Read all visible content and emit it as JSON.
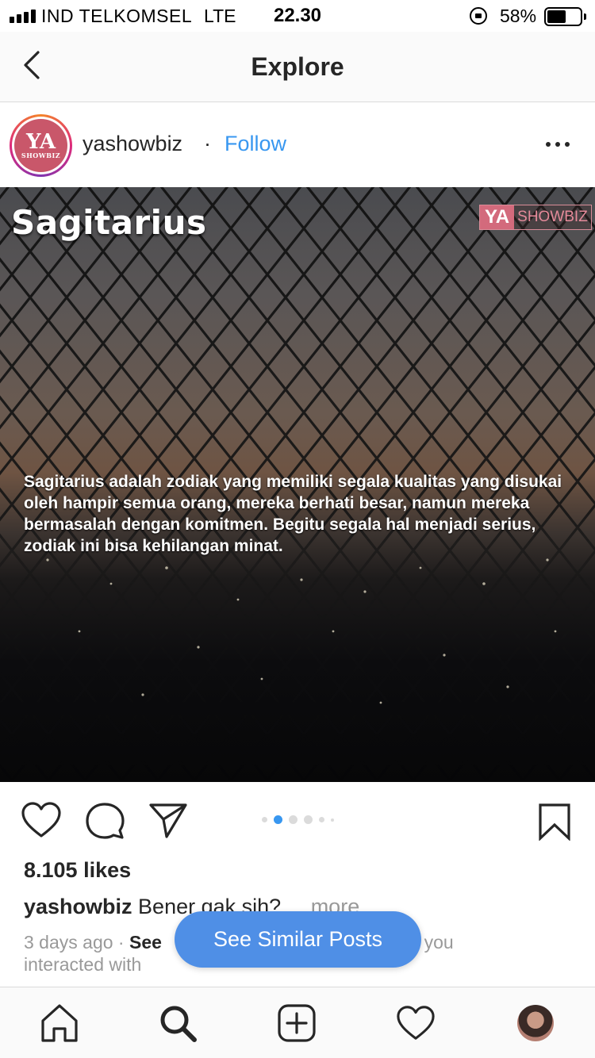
{
  "status_bar": {
    "carrier": "IND TELKOMSEL",
    "network": "LTE",
    "time": "22.30",
    "battery_percent": "58%",
    "battery_level": 0.58
  },
  "nav": {
    "title": "Explore"
  },
  "post": {
    "username": "yashowbiz",
    "separator": "·",
    "follow_label": "Follow",
    "avatar_logo": {
      "ya": "YA",
      "sub": "SHOWBIZ"
    },
    "image": {
      "title": "Sagitarius",
      "watermark_ya": "YA",
      "watermark_showbiz": "SHOWBIZ",
      "caption": "Sagitarius adalah zodiak yang memiliki segala kualitas yang disukai oleh hampir semua orang, mereka berhati besar, namun mereka bermasalah dengan komitmen. Begitu segala hal menjadi serius, zodiak ini bisa kehilangan minat."
    },
    "likes": "8.105 likes",
    "caption_user": "yashowbiz",
    "caption_text": "Bener gak sih?",
    "caption_more": "... more",
    "timestamp": "3 days ago",
    "meta_sep": " · ",
    "see_label": "See",
    "meta_rest": "ts you",
    "meta_line2": "interacted with",
    "carousel": {
      "count": 6,
      "active": 1
    }
  },
  "similar_button": "See Similar Posts",
  "icons": {
    "back": "chevron-left-icon",
    "more": "ellipsis-icon",
    "like": "heart-icon",
    "comment": "comment-bubble-icon",
    "share": "paper-plane-icon",
    "save": "bookmark-icon",
    "home": "home-icon",
    "search": "search-icon",
    "add": "plus-square-icon",
    "activity": "heart-icon",
    "profile": "profile-avatar"
  },
  "colors": {
    "link_blue": "#3897f0",
    "button_blue": "#4f8fe6",
    "brand_pink": "#d36a7c"
  }
}
